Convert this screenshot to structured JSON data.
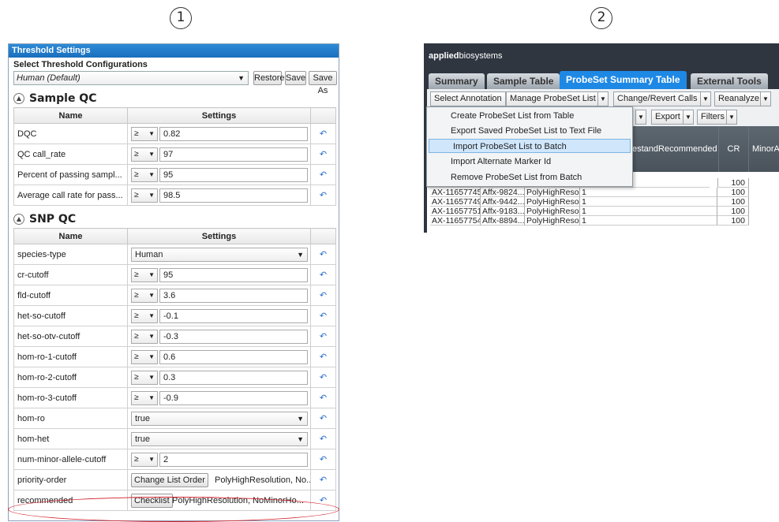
{
  "labels": {
    "panel1_number": "1",
    "panel2_number": "2"
  },
  "threshold": {
    "title": "Threshold Settings",
    "select_label": "Select Threshold Configurations",
    "config_value": "Human (Default)",
    "buttons": {
      "restore": "Restore",
      "save": "Save",
      "save_as": "Save As"
    },
    "col_name": "Name",
    "col_settings": "Settings",
    "sample_qc": {
      "heading": "Sample QC",
      "rows": [
        {
          "name": "DQC",
          "op": "≥",
          "value": "0.82"
        },
        {
          "name": "QC call_rate",
          "op": "≥",
          "value": "97"
        },
        {
          "name": "Percent of passing sampl...",
          "op": "≥",
          "value": "95"
        },
        {
          "name": "Average call rate for pass...",
          "op": "≥",
          "value": "98.5"
        }
      ]
    },
    "snp_qc": {
      "heading": "SNP QC",
      "species_type": {
        "name": "species-type",
        "value": "Human"
      },
      "numeric_rows": [
        {
          "name": "cr-cutoff",
          "op": "≥",
          "value": "95"
        },
        {
          "name": "fld-cutoff",
          "op": "≥",
          "value": "3.6"
        },
        {
          "name": "het-so-cutoff",
          "op": "≥",
          "value": "-0.1"
        },
        {
          "name": "het-so-otv-cutoff",
          "op": "≥",
          "value": "-0.3"
        },
        {
          "name": "hom-ro-1-cutoff",
          "op": "≥",
          "value": "0.6"
        },
        {
          "name": "hom-ro-2-cutoff",
          "op": "≥",
          "value": "0.3"
        },
        {
          "name": "hom-ro-3-cutoff",
          "op": "≥",
          "value": "-0.9"
        }
      ],
      "hom_ro": {
        "name": "hom-ro",
        "value": "true"
      },
      "hom_het": {
        "name": "hom-het",
        "value": "true"
      },
      "num_minor": {
        "name": "num-minor-allele-cutoff",
        "op": "≥",
        "value": "2"
      },
      "priority_order": {
        "name": "priority-order",
        "button": "Change List Order",
        "text": "PolyHighResolution, No..."
      },
      "recommended": {
        "name": "recommended",
        "button": "Checklist",
        "text": "PolyHighResolution, NoMinorHo..."
      }
    }
  },
  "probeset": {
    "brand_bold": "applied",
    "brand_rest": "biosystems",
    "tabs": [
      "Summary",
      "Sample Table",
      "ProbeSet Summary Table",
      "External Tools"
    ],
    "toolbar": {
      "select_annotation": "Select Annotation",
      "manage_list": "Manage ProbeSet List",
      "change_calls": "Change/Revert Calls",
      "reanalyze": "Reanalyze",
      "export": "Export",
      "filters": "Filters"
    },
    "menu": [
      "Create ProbeSet List from Table",
      "Export Saved ProbeSet List to Text File",
      "Import ProbeSet List to Batch",
      "Import Alternate Marker Id",
      "Remove ProbeSet List from Batch"
    ],
    "columns": {
      "bestand": "estandRecommended",
      "cr": "CR",
      "minor": "MinorA"
    },
    "rows": [
      {
        "id": "AX-11657745",
        "affx": "Affx-9824...",
        "cls": "PolyHighResol...",
        "best": "1",
        "cr": "100"
      },
      {
        "id": "AX-11657749",
        "affx": "Affx-9442...",
        "cls": "PolyHighResol...",
        "best": "1",
        "cr": "100"
      },
      {
        "id": "AX-11657751",
        "affx": "Affx-9183...",
        "cls": "PolyHighResol...",
        "best": "1",
        "cr": "100"
      },
      {
        "id": "AX-11657754",
        "affx": "Affx-8894...",
        "cls": "PolyHighResol...",
        "best": "1",
        "cr": "100"
      }
    ],
    "partial_row_cr": "100"
  }
}
